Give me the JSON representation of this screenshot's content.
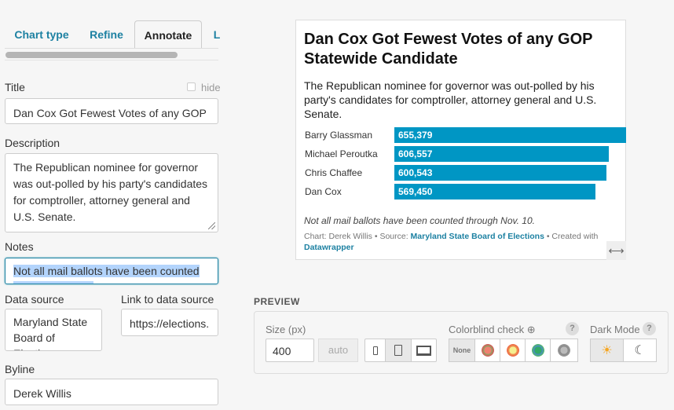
{
  "tabs": [
    {
      "label": "Chart type"
    },
    {
      "label": "Refine"
    },
    {
      "label": "Annotate",
      "active": true
    },
    {
      "label": "L"
    }
  ],
  "form": {
    "title_label": "Title",
    "hide_label": "hide",
    "title_value": "Dan Cox Got Fewest Votes of any GOP Statewide Candidate",
    "description_label": "Description",
    "description_value": "The Republican nominee for governor was out-polled by his party's candidates for comptroller, attorney general and U.S. Senate.",
    "notes_label": "Notes",
    "notes_value": "Not all mail ballots have been counted through Nov. 10.",
    "source_label": "Data source",
    "source_value": "Maryland State Board of Elections",
    "link_label": "Link to data source",
    "link_value": "https://elections.",
    "byline_label": "Byline",
    "byline_value": "Derek Willis"
  },
  "chart": {
    "title": "Dan Cox Got Fewest Votes of any GOP Statewide Candidate",
    "description": "The Republican nominee for governor was out-polled by his party's candidates for comptroller, attorney general and U.S. Senate.",
    "notes": "Not all mail ballots have been counted through Nov. 10.",
    "footer_prefix": "Chart: Derek Willis • Source: ",
    "footer_source": "Maryland State Board of Elections",
    "footer_mid": " • Created with ",
    "footer_dw": "Datawrapper",
    "bar_color": "#0096c4"
  },
  "chart_data": {
    "type": "bar",
    "orientation": "horizontal",
    "categories": [
      "Barry Glassman",
      "Michael Peroutka",
      "Chris Chaffee",
      "Dan Cox"
    ],
    "values": [
      655379,
      606557,
      600543,
      569450
    ],
    "labels": [
      "655,379",
      "606,557",
      "600,543",
      "569,450"
    ]
  },
  "preview": {
    "heading": "PREVIEW",
    "size_label": "Size (px)",
    "size_value": "400",
    "auto_label": "auto",
    "colorblind_label": "Colorblind check",
    "none_label": "None",
    "dark_label": "Dark Mode",
    "help": "?"
  }
}
